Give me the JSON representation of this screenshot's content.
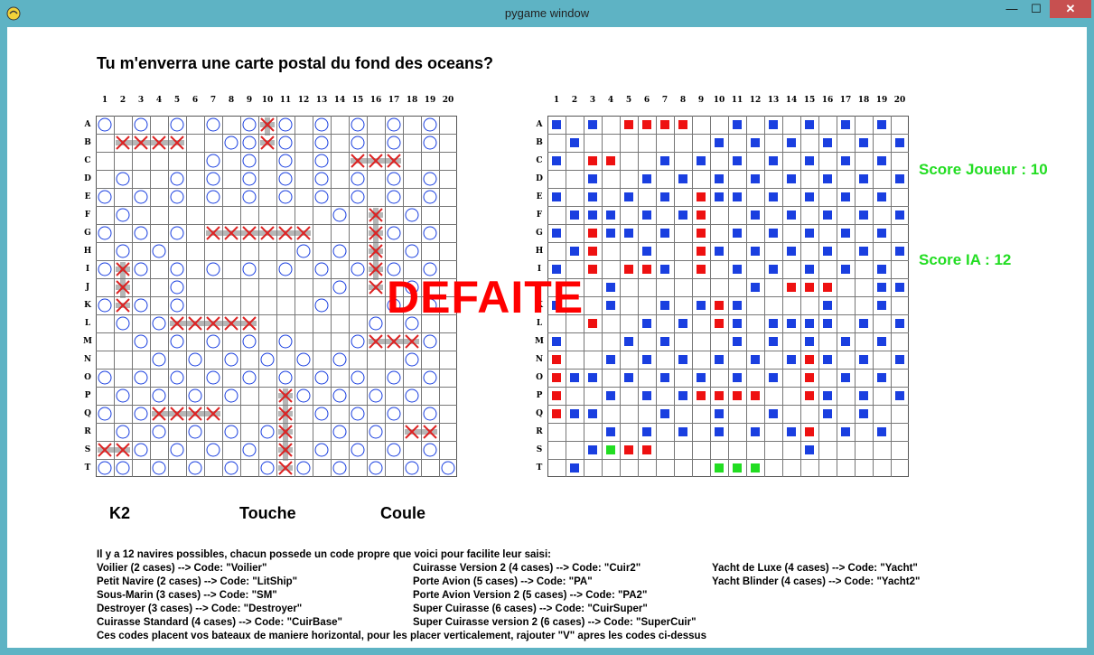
{
  "window": {
    "title": "pygame window",
    "minimize": "—",
    "maximize": "☐",
    "close": "✕"
  },
  "question": "Tu m'enverra une carte postal du fond des oceans?",
  "columns": [
    "1",
    "2",
    "3",
    "4",
    "5",
    "6",
    "7",
    "8",
    "9",
    "10",
    "11",
    "12",
    "13",
    "14",
    "15",
    "16",
    "17",
    "18",
    "19",
    "20"
  ],
  "rows": [
    "A",
    "B",
    "C",
    "D",
    "E",
    "F",
    "G",
    "H",
    "I",
    "J",
    "K",
    "L",
    "M",
    "N",
    "O",
    "P",
    "Q",
    "R",
    "S",
    "T"
  ],
  "colors": {
    "miss": "#1a3fe0",
    "hit": "#ee1111",
    "green": "#22dd22",
    "circle": "#1a3fe0",
    "cross": "#dd2222",
    "ship": "#7a7a7a",
    "defaite": "#ff0000"
  },
  "left_board": {
    "misses": [
      [
        0,
        [
          1,
          3,
          5,
          7,
          9,
          11,
          13,
          15,
          17,
          19
        ]
      ],
      [
        1,
        [
          8,
          9,
          11,
          13,
          15,
          17,
          19
        ]
      ],
      [
        2,
        [
          7,
          9,
          11,
          13
        ]
      ],
      [
        3,
        [
          2,
          5,
          7,
          9,
          11,
          13,
          15,
          17,
          19
        ]
      ],
      [
        4,
        [
          1,
          3,
          5,
          7,
          9,
          11,
          13,
          15,
          17,
          19
        ]
      ],
      [
        5,
        [
          2,
          14,
          16,
          18
        ]
      ],
      [
        6,
        [
          1,
          3,
          5,
          17,
          19
        ]
      ],
      [
        7,
        [
          2,
          4,
          12,
          14,
          16,
          18
        ]
      ],
      [
        8,
        [
          1,
          3,
          5,
          7,
          9,
          11,
          13,
          15,
          17,
          19
        ]
      ],
      [
        9,
        [
          5,
          14,
          18
        ]
      ],
      [
        10,
        [
          1,
          3,
          5,
          13,
          17,
          19
        ]
      ],
      [
        11,
        [
          2,
          4,
          16,
          18
        ]
      ],
      [
        12,
        [
          3,
          5,
          7,
          9,
          11,
          15,
          19
        ]
      ],
      [
        13,
        [
          4,
          6,
          8,
          10,
          12,
          14,
          18
        ]
      ],
      [
        14,
        [
          1,
          3,
          5,
          7,
          9,
          11,
          13,
          15,
          17,
          19
        ]
      ],
      [
        15,
        [
          2,
          4,
          6,
          8,
          12,
          14,
          16,
          18
        ]
      ],
      [
        16,
        [
          1,
          3,
          13,
          15,
          17,
          19
        ]
      ],
      [
        17,
        [
          2,
          4,
          6,
          8,
          10,
          14,
          16
        ]
      ],
      [
        18,
        [
          1,
          3,
          5,
          7,
          9,
          13,
          15,
          17,
          19
        ]
      ],
      [
        19,
        [
          1,
          2,
          4,
          6,
          8,
          10,
          12,
          14,
          16,
          18,
          20
        ]
      ]
    ],
    "hits": [
      [
        1,
        [
          2,
          3,
          4,
          5
        ]
      ],
      [
        0,
        [
          10
        ]
      ],
      [
        1,
        [
          10
        ]
      ],
      [
        2,
        [
          15,
          16,
          17
        ]
      ],
      [
        6,
        [
          7,
          8,
          9,
          10,
          11,
          12
        ]
      ],
      [
        5,
        [
          16
        ]
      ],
      [
        6,
        [
          16
        ]
      ],
      [
        7,
        [
          16
        ]
      ],
      [
        8,
        [
          16
        ]
      ],
      [
        9,
        [
          16
        ]
      ],
      [
        8,
        [
          2
        ]
      ],
      [
        9,
        [
          2
        ]
      ],
      [
        10,
        [
          2
        ]
      ],
      [
        11,
        [
          5,
          6,
          7,
          8,
          9
        ]
      ],
      [
        12,
        [
          16,
          17,
          18
        ]
      ],
      [
        15,
        [
          11
        ]
      ],
      [
        16,
        [
          11
        ]
      ],
      [
        17,
        [
          11
        ]
      ],
      [
        18,
        [
          11
        ]
      ],
      [
        19,
        [
          11
        ]
      ],
      [
        16,
        [
          4,
          5,
          6,
          7
        ]
      ],
      [
        17,
        [
          18,
          19
        ]
      ],
      [
        18,
        [
          1,
          2
        ]
      ]
    ]
  },
  "right_board": {
    "blue": [
      [
        0,
        [
          1,
          3,
          11,
          13,
          15,
          17,
          19
        ]
      ],
      [
        1,
        [
          2,
          10,
          12,
          14,
          16,
          18,
          20
        ]
      ],
      [
        2,
        [
          1,
          7,
          9,
          11,
          13,
          15,
          17,
          19
        ]
      ],
      [
        3,
        [
          3,
          6,
          8,
          10,
          12,
          14,
          16,
          18,
          20
        ]
      ],
      [
        4,
        [
          1,
          3,
          5,
          7,
          10,
          11,
          13,
          15,
          17,
          19
        ]
      ],
      [
        5,
        [
          2,
          3,
          4,
          6,
          8,
          12,
          14,
          16,
          18,
          20
        ]
      ],
      [
        6,
        [
          1,
          4,
          5,
          7,
          11,
          13,
          15,
          17,
          19
        ]
      ],
      [
        7,
        [
          2,
          6,
          10,
          12,
          14,
          16,
          18,
          20
        ]
      ],
      [
        8,
        [
          1,
          7,
          11,
          13,
          15,
          17,
          19
        ]
      ],
      [
        9,
        [
          4,
          12,
          19,
          20
        ]
      ],
      [
        10,
        [
          1,
          4,
          7,
          9,
          11,
          16,
          19
        ]
      ],
      [
        11,
        [
          6,
          8,
          11,
          13,
          14,
          15,
          16,
          18,
          20
        ]
      ],
      [
        12,
        [
          1,
          5,
          7,
          11,
          13,
          15,
          17,
          19
        ]
      ],
      [
        13,
        [
          4,
          6,
          8,
          10,
          12,
          14,
          16,
          18,
          20
        ]
      ],
      [
        14,
        [
          2,
          3,
          5,
          7,
          9,
          11,
          13,
          17,
          19
        ]
      ],
      [
        15,
        [
          4,
          6,
          8,
          16,
          18,
          20
        ]
      ],
      [
        16,
        [
          2,
          3,
          7,
          10,
          13,
          16,
          18
        ]
      ],
      [
        17,
        [
          4,
          6,
          8,
          10,
          12,
          14,
          17,
          19
        ]
      ],
      [
        18,
        [
          3,
          15
        ]
      ],
      [
        19,
        [
          2
        ]
      ]
    ],
    "red": [
      [
        0,
        [
          5,
          6,
          7,
          8
        ]
      ],
      [
        2,
        [
          3,
          4
        ]
      ],
      [
        4,
        [
          9
        ]
      ],
      [
        5,
        [
          9
        ]
      ],
      [
        6,
        [
          3,
          9
        ]
      ],
      [
        7,
        [
          3,
          9
        ]
      ],
      [
        8,
        [
          3,
          5,
          6,
          9
        ]
      ],
      [
        9,
        [
          14,
          15,
          16
        ]
      ],
      [
        10,
        [
          10
        ]
      ],
      [
        11,
        [
          3,
          10
        ]
      ],
      [
        13,
        [
          1,
          15
        ]
      ],
      [
        14,
        [
          1,
          15
        ]
      ],
      [
        15,
        [
          1,
          9,
          10,
          11,
          12,
          15
        ]
      ],
      [
        16,
        [
          1
        ]
      ],
      [
        17,
        [
          15
        ]
      ],
      [
        18,
        [
          5,
          6
        ]
      ]
    ],
    "green": [
      [
        18,
        [
          4
        ]
      ],
      [
        19,
        [
          10,
          11,
          12
        ]
      ]
    ]
  },
  "defaite": "DEFAITE",
  "score_player": "Score Joueur :  10",
  "score_ai": "Score IA : 12",
  "status_input": "K2",
  "status_touche": "Touche",
  "status_coule": "Coule",
  "info": {
    "intro": "Il y a 12 navires possibles, chacun possede un code propre que voici pour facilite leur saisi:",
    "col1": [
      "Voilier (2 cases) --> Code: \"Voilier\"",
      "Petit Navire (2 cases) --> Code: \"LitShip\"",
      "Sous-Marin (3 cases) --> Code: \"SM\"",
      "Destroyer (3 cases) --> Code: \"Destroyer\"",
      "Cuirasse Standard (4 cases) --> Code: \"CuirBase\""
    ],
    "col2": [
      "Cuirasse Version 2 (4 cases) --> Code: \"Cuir2\"",
      "Porte Avion (5 cases) --> Code: \"PA\"",
      "Porte Avion Version 2 (5 cases) --> Code: \"PA2\"",
      "Super Cuirasse (6 cases) --> Code: \"CuirSuper\"",
      "Super Cuirasse version 2 (6 cases) --> Code: \"SuperCuir\""
    ],
    "col3": [
      "Yacht de Luxe (4 cases) --> Code: \"Yacht\"",
      "Yacht Blinder (4 cases) --> Code: \"Yacht2\""
    ],
    "footer": "Ces codes placent vos bateaux de maniere horizontal, pour les placer verticalement, rajouter \"V\" apres les codes ci-dessus"
  }
}
